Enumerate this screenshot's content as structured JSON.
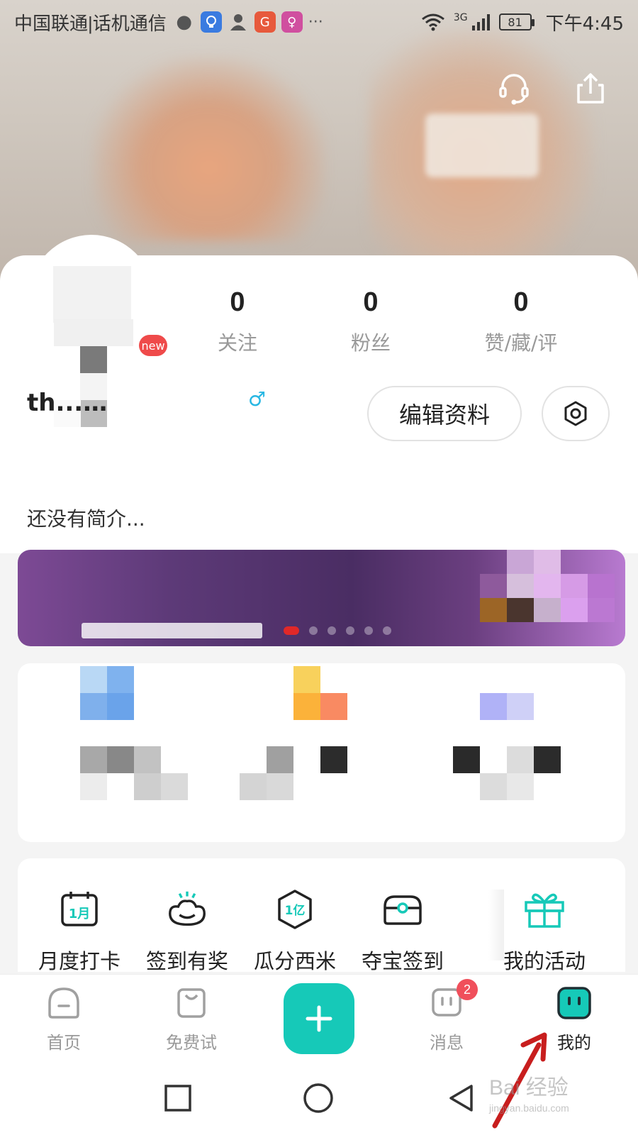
{
  "status_bar": {
    "carrier": "中国联通|话机通信",
    "network": "3G",
    "battery": "81",
    "time": "下午4:45",
    "more": "···"
  },
  "profile": {
    "username": "th...",
    "username_suffix": "…",
    "new_badge": "new",
    "stats": [
      {
        "value": "0",
        "label": "关注"
      },
      {
        "value": "0",
        "label": "粉丝"
      },
      {
        "value": "0",
        "label": "赞/藏/评"
      }
    ],
    "edit_label": "编辑资料",
    "bio": "还没有简介..."
  },
  "activities": [
    {
      "label": "月度打卡",
      "icon": "calendar-1month-icon"
    },
    {
      "label": "签到有奖",
      "icon": "cloud-smile-icon"
    },
    {
      "label": "瓜分西米",
      "icon": "hexagon-1yi-icon"
    },
    {
      "label": "夺宝签到",
      "icon": "treasure-box-icon"
    },
    {
      "label": "我的活动",
      "icon": "gift-icon"
    }
  ],
  "bottom_nav": [
    {
      "label": "首页",
      "icon": "home-face-icon"
    },
    {
      "label": "免费试",
      "icon": "bag-icon"
    },
    {
      "label": "",
      "icon": "plus-icon"
    },
    {
      "label": "消息",
      "icon": "message-icon",
      "badge": "2"
    },
    {
      "label": "我的",
      "icon": "me-face-icon",
      "active": true
    }
  ],
  "watermark": {
    "title": "Bai 经验",
    "sub": "jingyan.baidu.com"
  },
  "colors": {
    "accent": "#16c9b8",
    "badge_red": "#f04f5b",
    "gender_blue": "#28b7e3"
  }
}
